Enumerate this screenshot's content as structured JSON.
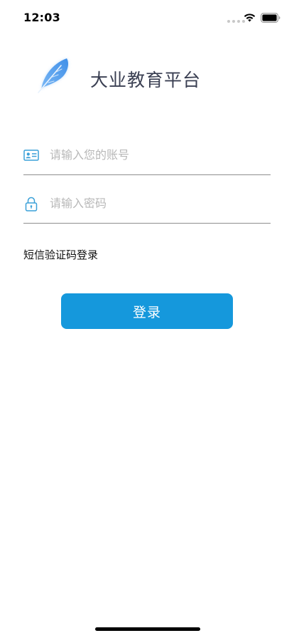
{
  "status_bar": {
    "time": "12:03",
    "icons": [
      "signal-dots-icon",
      "wifi-icon",
      "battery-icon"
    ]
  },
  "brand": {
    "logo_icon": "feather-icon",
    "title": "大业教育平台"
  },
  "form": {
    "account": {
      "icon": "id-card-icon",
      "placeholder": "请输入您的账号",
      "value": ""
    },
    "password": {
      "icon": "lock-icon",
      "placeholder": "请输入密码",
      "value": ""
    },
    "sms_login_label": "短信验证码登录",
    "login_button_label": "登录"
  },
  "colors": {
    "primary": "#1598dc",
    "title_text": "#3a3f52",
    "placeholder": "#b8b8b8",
    "divider": "#8e8e8e",
    "icon_blue": "#3aa0d8",
    "logo_blue": "#5aa5f0"
  }
}
